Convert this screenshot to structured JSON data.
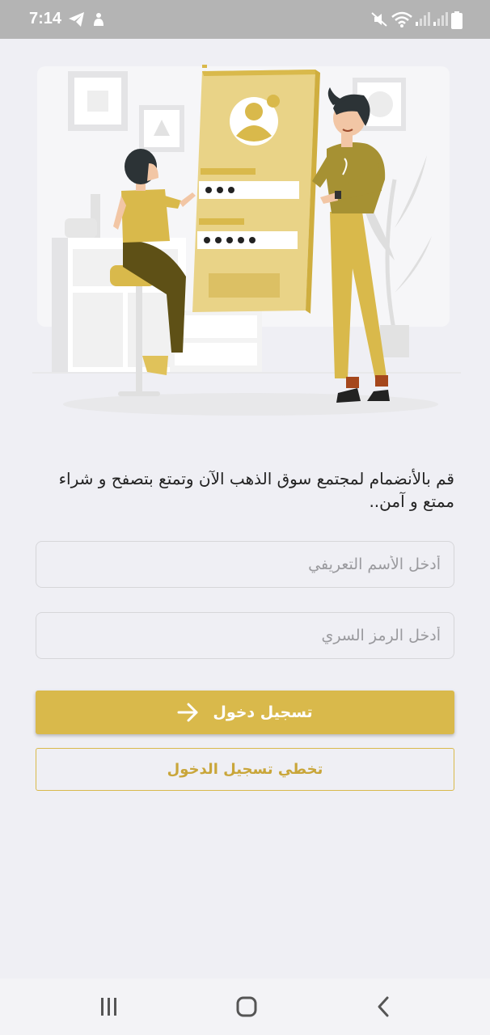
{
  "status_bar": {
    "time": "7:14",
    "icons": [
      "telegram-icon",
      "notification-icon",
      "mute-icon",
      "wifi-icon",
      "signal-icon",
      "signal-icon",
      "battery-icon"
    ]
  },
  "colors": {
    "accent": "#d9b94b",
    "background": "#efeff4",
    "status_bar": "#b4b4b4"
  },
  "login": {
    "intro_text": "قم بالأنضمام لمجتمع سوق الذهب الآن وتمتع بتصفح و شراء ممتع و آمن..",
    "username_placeholder": "أدخل الأسم التعريفي",
    "password_placeholder": "أدخل الرمز السري",
    "login_label": "تسجيل دخول",
    "skip_label": "تخطي تسجيل الدخول"
  },
  "nav_bar": {
    "icons": [
      "recent-apps-icon",
      "home-icon",
      "back-icon"
    ]
  }
}
